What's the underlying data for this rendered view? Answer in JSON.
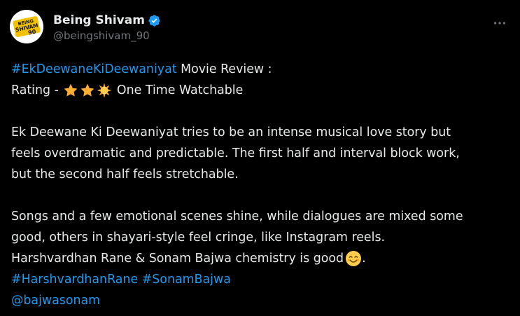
{
  "author": {
    "display_name": "Being Shivam",
    "handle": "@beingshivam_90",
    "avatar_text_1": "BEING",
    "avatar_text_2": "SHIVAM",
    "avatar_text_3": "90"
  },
  "tweet": {
    "hashtag_title": "#EkDeewaneKiDeewaniyat",
    "title_suffix": " Movie Review :",
    "rating_label": "Rating - ",
    "rating_stars": 2.5,
    "rating_text": " One Time Watchable",
    "para1_line1": "Ek Deewane Ki Deewaniyat tries to be an intense musical love story but",
    "para1_line2": "feels overdramatic and predictable. The first half and interval block work,",
    "para1_line3": "but the second half feels stretchable.",
    "para2_line1": "Songs and a few emotional scenes shine, while dialogues are mixed some",
    "para2_line2": "good, others in shayari-style feel cringe, like Instagram reels.",
    "para2_line3": "Harshvardhan Rane & Sonam Bajwa chemistry is good",
    "para2_line3_end": ".",
    "hashtag_1": "#HarshvardhanRane",
    "hashtag_2": "#SonamBajwa",
    "mention": "@bajwasonam"
  },
  "icons": {
    "verified": "verified-badge-icon",
    "more": "more-options-icon",
    "star": "star-icon",
    "sun": "sun-icon",
    "smile": "smiling-face-emoji"
  },
  "colors": {
    "background": "#000000",
    "text": "#e7e9ea",
    "secondary": "#71767b",
    "link": "#1d9bf0",
    "verified": "#1d9bf0"
  }
}
